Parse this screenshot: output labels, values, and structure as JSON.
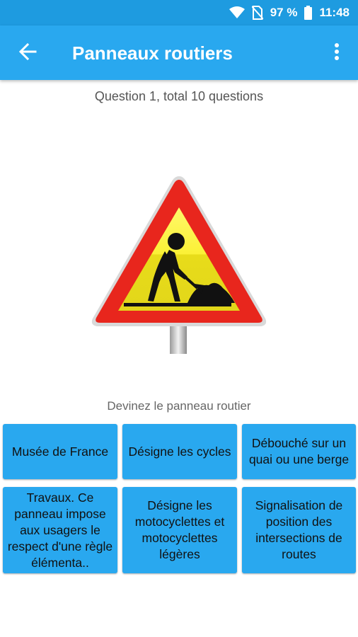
{
  "status_bar": {
    "wifi_icon": "wifi-icon",
    "no_sim_icon": "no-sim-icon",
    "battery_percent": "97 %",
    "battery_icon": "battery-icon",
    "time": "11:48"
  },
  "app_bar": {
    "back_icon": "arrow-left-icon",
    "title": "Panneaux routiers",
    "more_icon": "more-vert-icon"
  },
  "quiz": {
    "counter": "Question 1, total 10 questions",
    "sign_icon": "roadworks-warning-sign",
    "prompt": "Devinez le panneau routier",
    "answers": [
      "Musée de France",
      "Désigne les cycles",
      "Débouché sur un quai ou une berge",
      "Travaux. Ce panneau impose aux usagers le respect d'une règle élémenta..",
      "Désigne les motocyclettes et motocyclettes légères",
      "Signalisation de position des intersections de routes"
    ]
  },
  "colors": {
    "status_bar": "#1e9be0",
    "app_bar": "#29a8ef",
    "answer_button": "#29a8ef",
    "sign_red": "#e8261d",
    "sign_yellow": "#f6ea1e"
  }
}
